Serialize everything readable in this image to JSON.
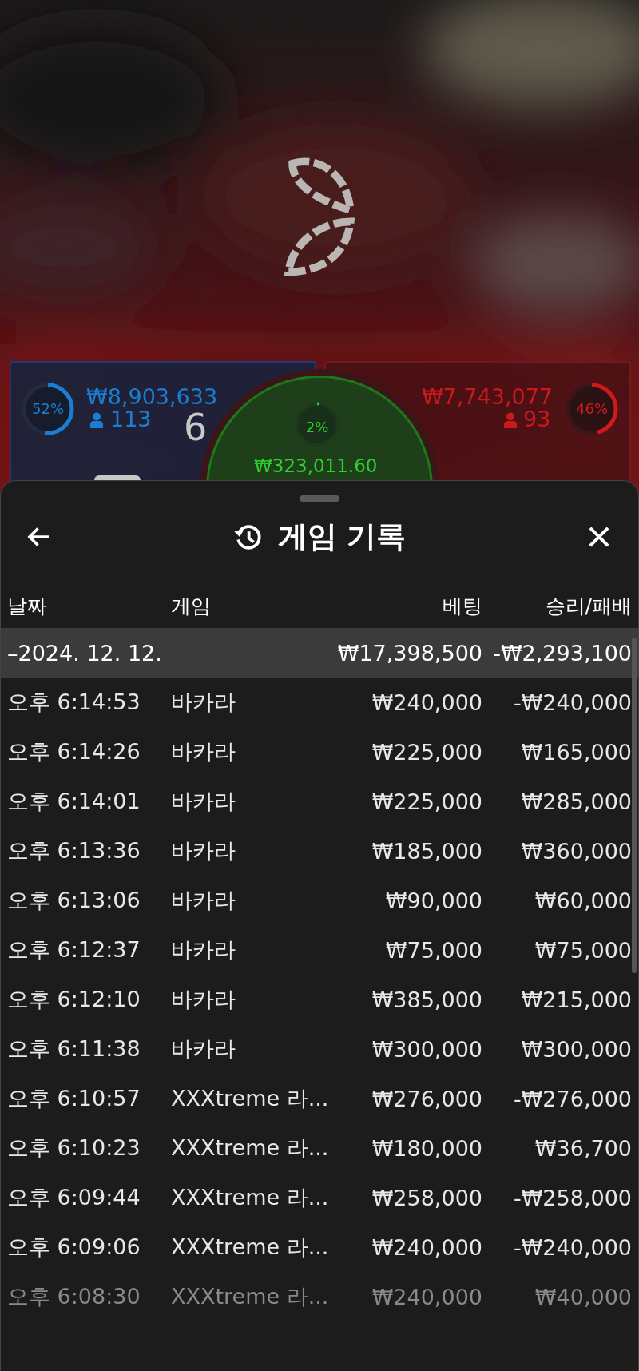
{
  "scoreboard": {
    "player": {
      "percent": "52%",
      "level": 0.52,
      "amount": "₩8,903,633",
      "players": "113",
      "score": "6"
    },
    "tie": {
      "percent": "2%",
      "level": 0.02,
      "amount": "₩323,011.60"
    },
    "banker": {
      "percent": "46%",
      "level": 0.46,
      "amount": "₩7,743,077",
      "players": "93"
    }
  },
  "sheet": {
    "title": "게임 기록",
    "columns": [
      "날짜",
      "게임",
      "베팅",
      "승리/패배"
    ],
    "date_group": {
      "date": "–2024. 12. 12.",
      "bet": "₩17,398,500",
      "result": "-₩2,293,100"
    },
    "rows": [
      {
        "time": "오후 6:14:53",
        "game": "바카라",
        "bet": "₩240,000",
        "result": "-₩240,000",
        "faded": false
      },
      {
        "time": "오후 6:14:26",
        "game": "바카라",
        "bet": "₩225,000",
        "result": "₩165,000",
        "faded": false
      },
      {
        "time": "오후 6:14:01",
        "game": "바카라",
        "bet": "₩225,000",
        "result": "₩285,000",
        "faded": false
      },
      {
        "time": "오후 6:13:36",
        "game": "바카라",
        "bet": "₩185,000",
        "result": "₩360,000",
        "faded": false
      },
      {
        "time": "오후 6:13:06",
        "game": "바카라",
        "bet": "₩90,000",
        "result": "₩60,000",
        "faded": false
      },
      {
        "time": "오후 6:12:37",
        "game": "바카라",
        "bet": "₩75,000",
        "result": "₩75,000",
        "faded": false
      },
      {
        "time": "오후 6:12:10",
        "game": "바카라",
        "bet": "₩385,000",
        "result": "₩215,000",
        "faded": false
      },
      {
        "time": "오후 6:11:38",
        "game": "바카라",
        "bet": "₩300,000",
        "result": "₩300,000",
        "faded": false
      },
      {
        "time": "오후 6:10:57",
        "game": "XXXtreme 라...",
        "bet": "₩276,000",
        "result": "-₩276,000",
        "faded": false
      },
      {
        "time": "오후 6:10:23",
        "game": "XXXtreme 라...",
        "bet": "₩180,000",
        "result": "₩36,700",
        "faded": false
      },
      {
        "time": "오후 6:09:44",
        "game": "XXXtreme 라...",
        "bet": "₩258,000",
        "result": "-₩258,000",
        "faded": false
      },
      {
        "time": "오후 6:09:06",
        "game": "XXXtreme 라...",
        "bet": "₩240,000",
        "result": "-₩240,000",
        "faded": false
      },
      {
        "time": "오후 6:08:30",
        "game": "XXXtreme 라...",
        "bet": "₩240,000",
        "result": "₩40,000",
        "faded": true
      }
    ]
  }
}
